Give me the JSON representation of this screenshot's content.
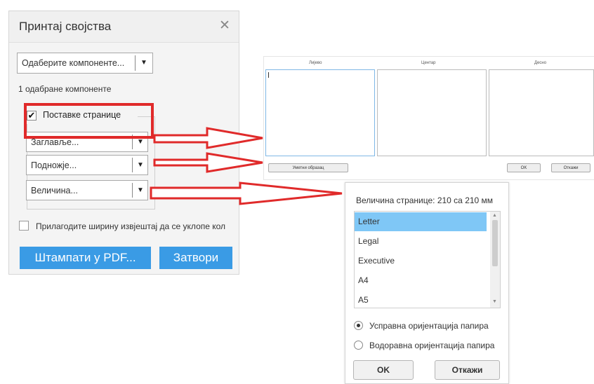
{
  "dialog": {
    "title": "Принтај својства",
    "close_glyph": "✕",
    "component_select": "Одаберите компоненте...",
    "selected_count": "1 одабране компоненте",
    "page_settings": {
      "label": "Поставке странице",
      "checked": true
    },
    "header_select": "Заглавље...",
    "footer_select": "Подножје...",
    "size_select": "Величина...",
    "fit_width": {
      "label": "Прилагодите ширину извјештај да се уклопе кол",
      "checked": false
    },
    "pdf_button": "Штампати у PDF...",
    "close_button": "Затвори"
  },
  "preview": {
    "tabs": [
      "Лијево",
      "Центар",
      "Десно"
    ],
    "insert_button": "Уметни образац",
    "ok_button": "OK",
    "cancel_button": "Откажи"
  },
  "size_dialog": {
    "title": "Величина странице: 210 са 210 мм",
    "options": [
      "Letter",
      "Legal",
      "Executive",
      "A4",
      "A5"
    ],
    "selected": "Letter",
    "portrait_label": "Усправна оријентација папира",
    "landscape_label": "Водоравна оријентација папира",
    "orientation": "portrait",
    "ok_button": "OK",
    "cancel_button": "Откажи"
  },
  "colors": {
    "accent": "#3a9be5",
    "highlight": "#e02a2a",
    "selection": "#7fc7f6"
  }
}
